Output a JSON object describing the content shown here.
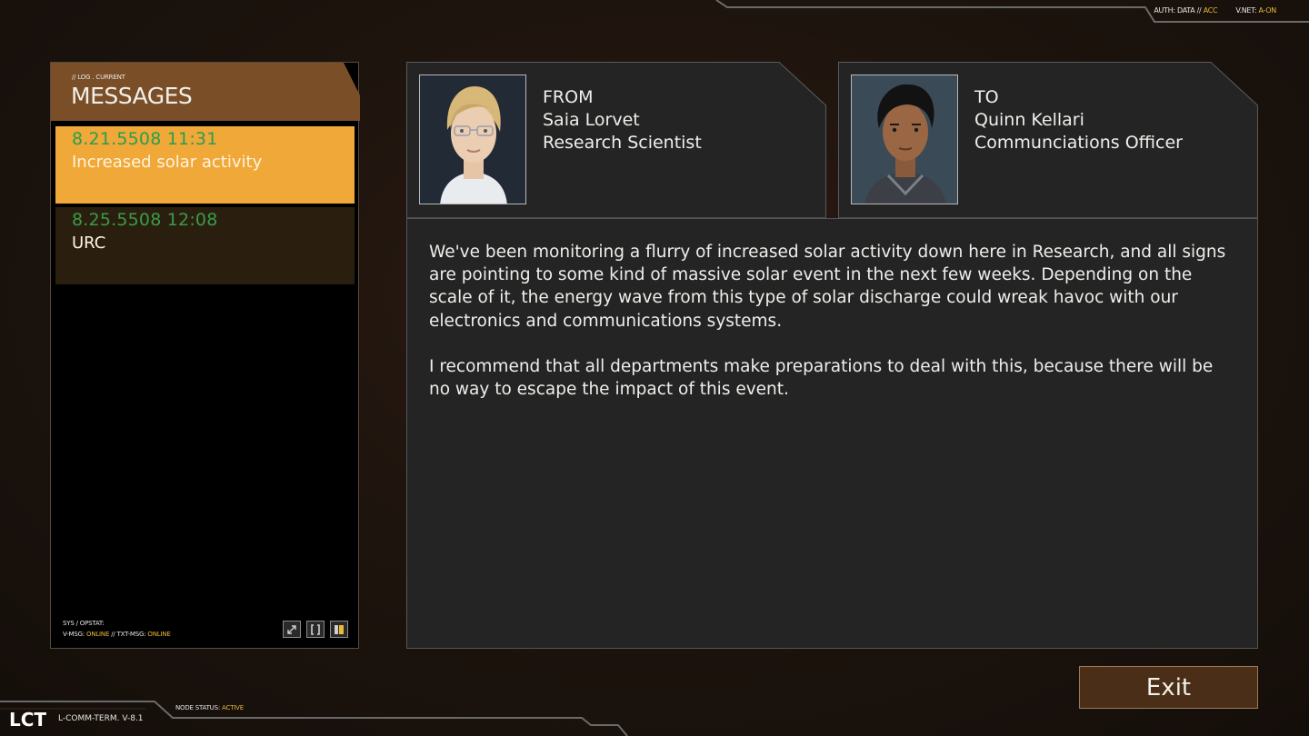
{
  "top_status": {
    "auth_label": "AUTH: DATA //",
    "auth_value": "ACC",
    "vnet_label": "V.NET:",
    "vnet_value": "A-ON"
  },
  "messages_panel": {
    "subtitle": "// LOG . CURRENT",
    "title": "MESSAGES",
    "items": [
      {
        "date": "8.21.5508 11:31",
        "subject": "Increased solar activity",
        "selected": true
      },
      {
        "date": "8.25.5508 12:08",
        "subject": "URC",
        "selected": false
      }
    ],
    "footer": {
      "line1": "SYS / OPSTAT:",
      "vmsg_label": "V-MSG:",
      "vmsg_value": "ONLINE",
      "sep": "//",
      "txtmsg_label": "TXT-MSG:",
      "txtmsg_value": "ONLINE"
    },
    "footer_icons": [
      "expand-icon",
      "bracket-icon",
      "panel-toggle-icon"
    ]
  },
  "from_card": {
    "heading": "FROM",
    "name": "Saia Lorvet",
    "role": "Research Scientist"
  },
  "to_card": {
    "heading": "TO",
    "name": "Quinn Kellari",
    "role": "Communciations Officer"
  },
  "message_body": {
    "paragraphs": [
      "We've been monitoring a flurry of increased solar activity down here in Research, and all signs are pointing to some kind of massive solar event in the next few weeks. Depending on the scale of it, the energy wave from this type of solar discharge could wreak havoc with our electronics and communications systems.",
      "I recommend that all departments make preparations to deal with this, because there will be no way to escape the impact of this event."
    ]
  },
  "exit_button": {
    "label": "Exit"
  },
  "bottom_bar": {
    "logo": "LCT",
    "version": "L-COMM-TERM. V-8.1",
    "node_status_label": "NODE STATUS:",
    "node_status_value": "ACTIVE"
  },
  "colors": {
    "accent_orange": "#f0a838",
    "header_brown": "#7a4f28",
    "date_green": "#2b9d4f",
    "status_yellow": "#e8b93a",
    "panel_gray": "#242424"
  }
}
